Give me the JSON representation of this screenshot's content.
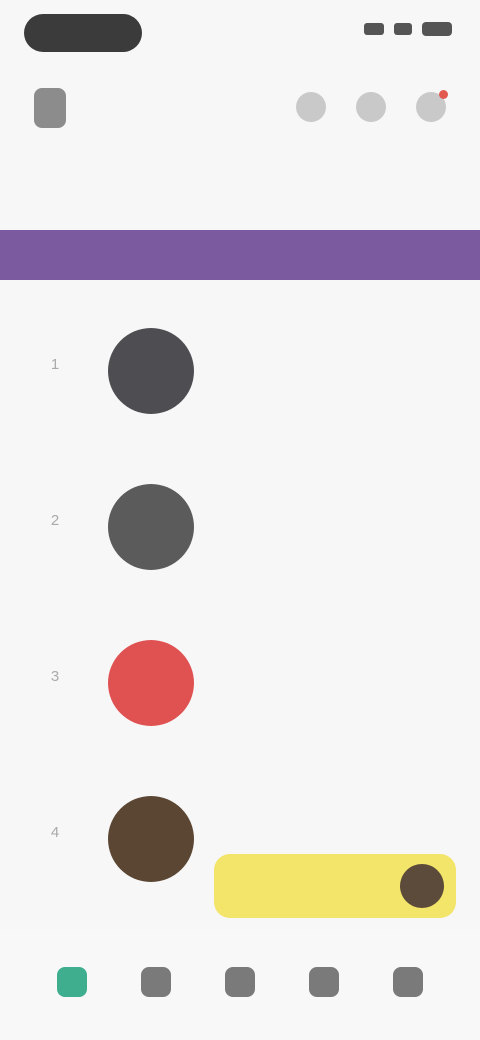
{
  "status_bar": {
    "time": ""
  },
  "header": {
    "brand_name": "",
    "icons": [
      "search-icon",
      "bookmark-icon",
      "notification-icon"
    ],
    "notification_dot_color": "#e25a4f"
  },
  "section": {
    "title": "",
    "subtitle": ""
  },
  "banner": {
    "text": "",
    "color": "#7b5aa0"
  },
  "list": {
    "items": [
      {
        "rank": "1",
        "meta": "",
        "title": "",
        "thumb_color": "#4e4e52"
      },
      {
        "rank": "2",
        "meta": "",
        "title": "",
        "thumb_color": "#5b5b5b"
      },
      {
        "rank": "3",
        "meta": "",
        "title": "",
        "thumb_color": "#e05252"
      },
      {
        "rank": "4",
        "meta": "",
        "title": "",
        "thumb_color": "#5a4632"
      }
    ]
  },
  "promo": {
    "text": "",
    "color": "#f3e46a"
  },
  "bottom_nav": {
    "items": [
      {
        "label": "",
        "icon": "home-icon",
        "active": true
      },
      {
        "label": "",
        "icon": "explore-icon",
        "active": false
      },
      {
        "label": "",
        "icon": "library-icon",
        "active": false
      },
      {
        "label": "",
        "icon": "messages-icon",
        "active": false
      },
      {
        "label": "",
        "icon": "profile-icon",
        "active": false
      }
    ],
    "accent_color": "#3fae8f"
  }
}
